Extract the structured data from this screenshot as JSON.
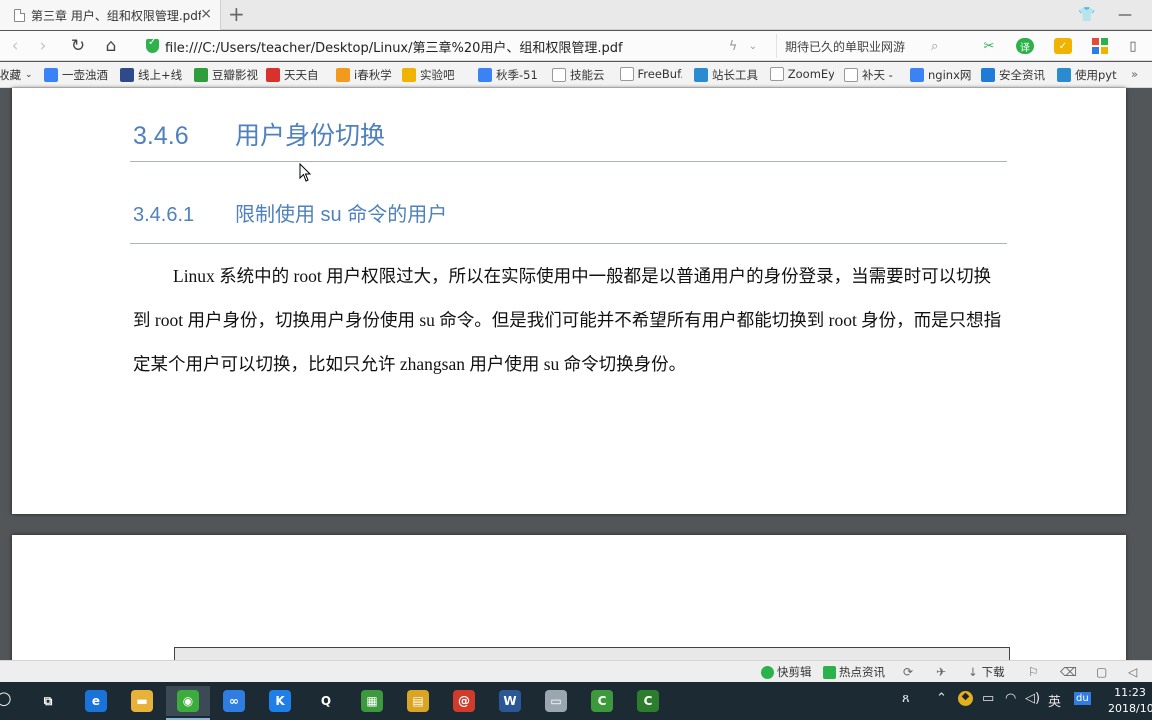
{
  "browser": {
    "tab": {
      "title": "第三章 用户、组和权限管理.pdf",
      "close": "×"
    },
    "new_tab": "+",
    "window_controls": {
      "skin": "👕",
      "minimize": "—"
    },
    "address": {
      "url": "file:///C:/Users/teacher/Desktop/Linux/第三章%20用户、组和权限管理.pdf",
      "search_text": "期待已久的单职业网游"
    },
    "bookmarks": [
      {
        "label": "收藏",
        "color": "#ffffff"
      },
      {
        "label": "一壶浊酒",
        "color": "#3b82f6"
      },
      {
        "label": "线上+线",
        "color": "#2e4a8a"
      },
      {
        "label": "豆瓣影视",
        "color": "#2e9d3c"
      },
      {
        "label": "天天自",
        "color": "#d9312b"
      },
      {
        "label": "i春秋学",
        "color": "#f39a1e"
      },
      {
        "label": "实验吧",
        "color": "#f0b400"
      },
      {
        "label": "秋季-51",
        "color": "#3b82f6"
      },
      {
        "label": "技能云",
        "color": "#ffffff"
      },
      {
        "label": "FreeBuf.",
        "color": "#ffffff"
      },
      {
        "label": "站长工具",
        "color": "#2a8bd0"
      },
      {
        "label": "ZoomEy",
        "color": "#ffffff"
      },
      {
        "label": "补天 -",
        "color": "#ffffff"
      },
      {
        "label": "nginx网",
        "color": "#3b82f6"
      },
      {
        "label": "安全资讯",
        "color": "#1f7ad8"
      },
      {
        "label": "使用pyt",
        "color": "#2a8bd0"
      }
    ],
    "more_bookmarks": "»"
  },
  "document": {
    "heading1": {
      "number": "3.4.6",
      "text": "用户身份切换"
    },
    "heading2": {
      "number": "3.4.6.1",
      "text": "限制使用 su 命令的用户"
    },
    "paragraph": "Linux 系统中的 root 用户权限过大，所以在实际使用中一般都是以普通用户的身份登录，当需要时可以切换到 root 用户身份，切换用户身份使用 su 命令。但是我们可能并不希望所有用户都能切换到 root 身份，而是只想指定某个用户可以切换，比如只允许 zhangsan 用户使用 su 命令切换身份。"
  },
  "statusbar": {
    "items": [
      {
        "label": "快剪辑",
        "color": "#2bb24c"
      },
      {
        "label": "热点资讯",
        "color": "#2bb24c"
      }
    ],
    "download": "下载"
  },
  "taskbar": {
    "apps": [
      {
        "name": "task-view",
        "glyph": "⧉",
        "color": "#1c2a33"
      },
      {
        "name": "edge",
        "glyph": "e",
        "color": "#1a73d8"
      },
      {
        "name": "file-explorer",
        "glyph": "▬",
        "color": "#e7b23a"
      },
      {
        "name": "360-browser",
        "glyph": "◉",
        "color": "#3cad3c"
      },
      {
        "name": "baidu-netdisk",
        "glyph": "∞",
        "color": "#2f7de1"
      },
      {
        "name": "kugou",
        "glyph": "K",
        "color": "#1f7ee8"
      },
      {
        "name": "qq",
        "glyph": "Q",
        "color": "#1c2a33"
      },
      {
        "name": "excel-tool",
        "glyph": "▦",
        "color": "#3c9a3c"
      },
      {
        "name": "notepad",
        "glyph": "▤",
        "color": "#d9a522"
      },
      {
        "name": "snail-app",
        "glyph": "@",
        "color": "#d13b2b"
      },
      {
        "name": "word",
        "glyph": "W",
        "color": "#2b5797"
      },
      {
        "name": "remote-desktop",
        "glyph": "▭",
        "color": "#9aa7b0"
      },
      {
        "name": "camtasia-green",
        "glyph": "C",
        "color": "#3c9a3c"
      },
      {
        "name": "camtasia-recorder",
        "glyph": "C",
        "color": "#2c7d2c"
      }
    ],
    "tray": {
      "ime": "英",
      "baidu": "du"
    },
    "time": "11:23",
    "date": "2018/10/"
  }
}
